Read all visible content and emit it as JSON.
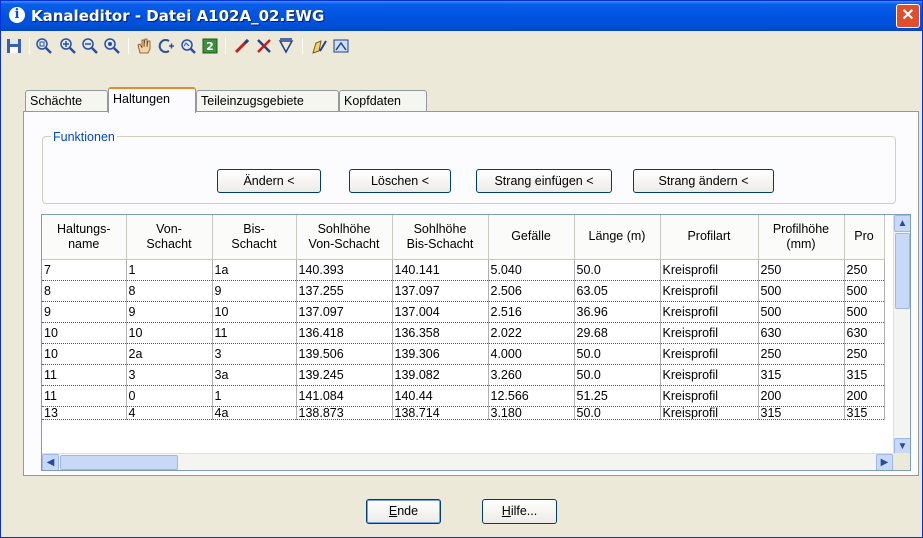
{
  "window": {
    "title": "Kanaleditor - Datei A102A_02.EWG",
    "icon": "info-icon",
    "close": "close-icon"
  },
  "toolbar": {
    "icons": [
      "save-icon",
      "zoom-window-icon",
      "zoom-in-icon",
      "zoom-out-icon",
      "zoom-extents-icon",
      "pan-icon",
      "select-add-icon",
      "select-remove-icon",
      "refresh-icon",
      "edit-pen-icon",
      "tools-icon",
      "filter-icon",
      "layer-edit-icon",
      "export-icon"
    ]
  },
  "tabs": [
    "Schächte",
    "Haltungen",
    "Teileinzugsgebiete",
    "Kopfdaten"
  ],
  "active_tab": "Haltungen",
  "funktionen": {
    "legend": "Funktionen",
    "buttons": {
      "aendern": "Ändern <",
      "loeschen": "Löschen <",
      "strang_einfuegen": "Strang einfügen <",
      "strang_aendern": "Strang ändern <"
    }
  },
  "table": {
    "headers": [
      [
        "Haltungs-",
        "name"
      ],
      [
        "Von-",
        "Schacht"
      ],
      [
        "Bis-",
        "Schacht"
      ],
      [
        "Sohlhöhe",
        "Von-Schacht"
      ],
      [
        "Sohlhöhe",
        "Bis-Schacht"
      ],
      [
        "Gefälle",
        ""
      ],
      [
        "Länge (m)",
        ""
      ],
      [
        "Profilart",
        ""
      ],
      [
        "Profilhöhe",
        "(mm)"
      ],
      [
        "Pro",
        ""
      ]
    ],
    "rows": [
      [
        "7",
        "1",
        "1a",
        "140.393",
        "140.141",
        "5.040",
        "50.0",
        "Kreisprofil",
        "250",
        "250"
      ],
      [
        "8",
        "8",
        "9",
        "137.255",
        "137.097",
        "2.506",
        "63.05",
        "Kreisprofil",
        "500",
        "500"
      ],
      [
        "9",
        "9",
        "10",
        "137.097",
        "137.004",
        "2.516",
        "36.96",
        "Kreisprofil",
        "500",
        "500"
      ],
      [
        "10",
        "10",
        "11",
        "136.418",
        "136.358",
        "2.022",
        "29.68",
        "Kreisprofil",
        "630",
        "630"
      ],
      [
        "10",
        "2a",
        "3",
        "139.506",
        "139.306",
        "4.000",
        "50.0",
        "Kreisprofil",
        "250",
        "250"
      ],
      [
        "11",
        "3",
        "3a",
        "139.245",
        "139.082",
        "3.260",
        "50.0",
        "Kreisprofil",
        "315",
        "315"
      ],
      [
        "11",
        "0",
        "1",
        "141.084",
        "140.44",
        "12.566",
        "51.25",
        "Kreisprofil",
        "200",
        "200"
      ],
      [
        "13",
        "4",
        "4a",
        "138.873",
        "138.714",
        "3.180",
        "50.0",
        "Kreisprofil",
        "315",
        "315"
      ]
    ]
  },
  "footer": {
    "ende_mnemonic": "E",
    "ende_rest": "nde",
    "hilfe_mnemonic": "H",
    "hilfe_rest": "ilfe..."
  }
}
